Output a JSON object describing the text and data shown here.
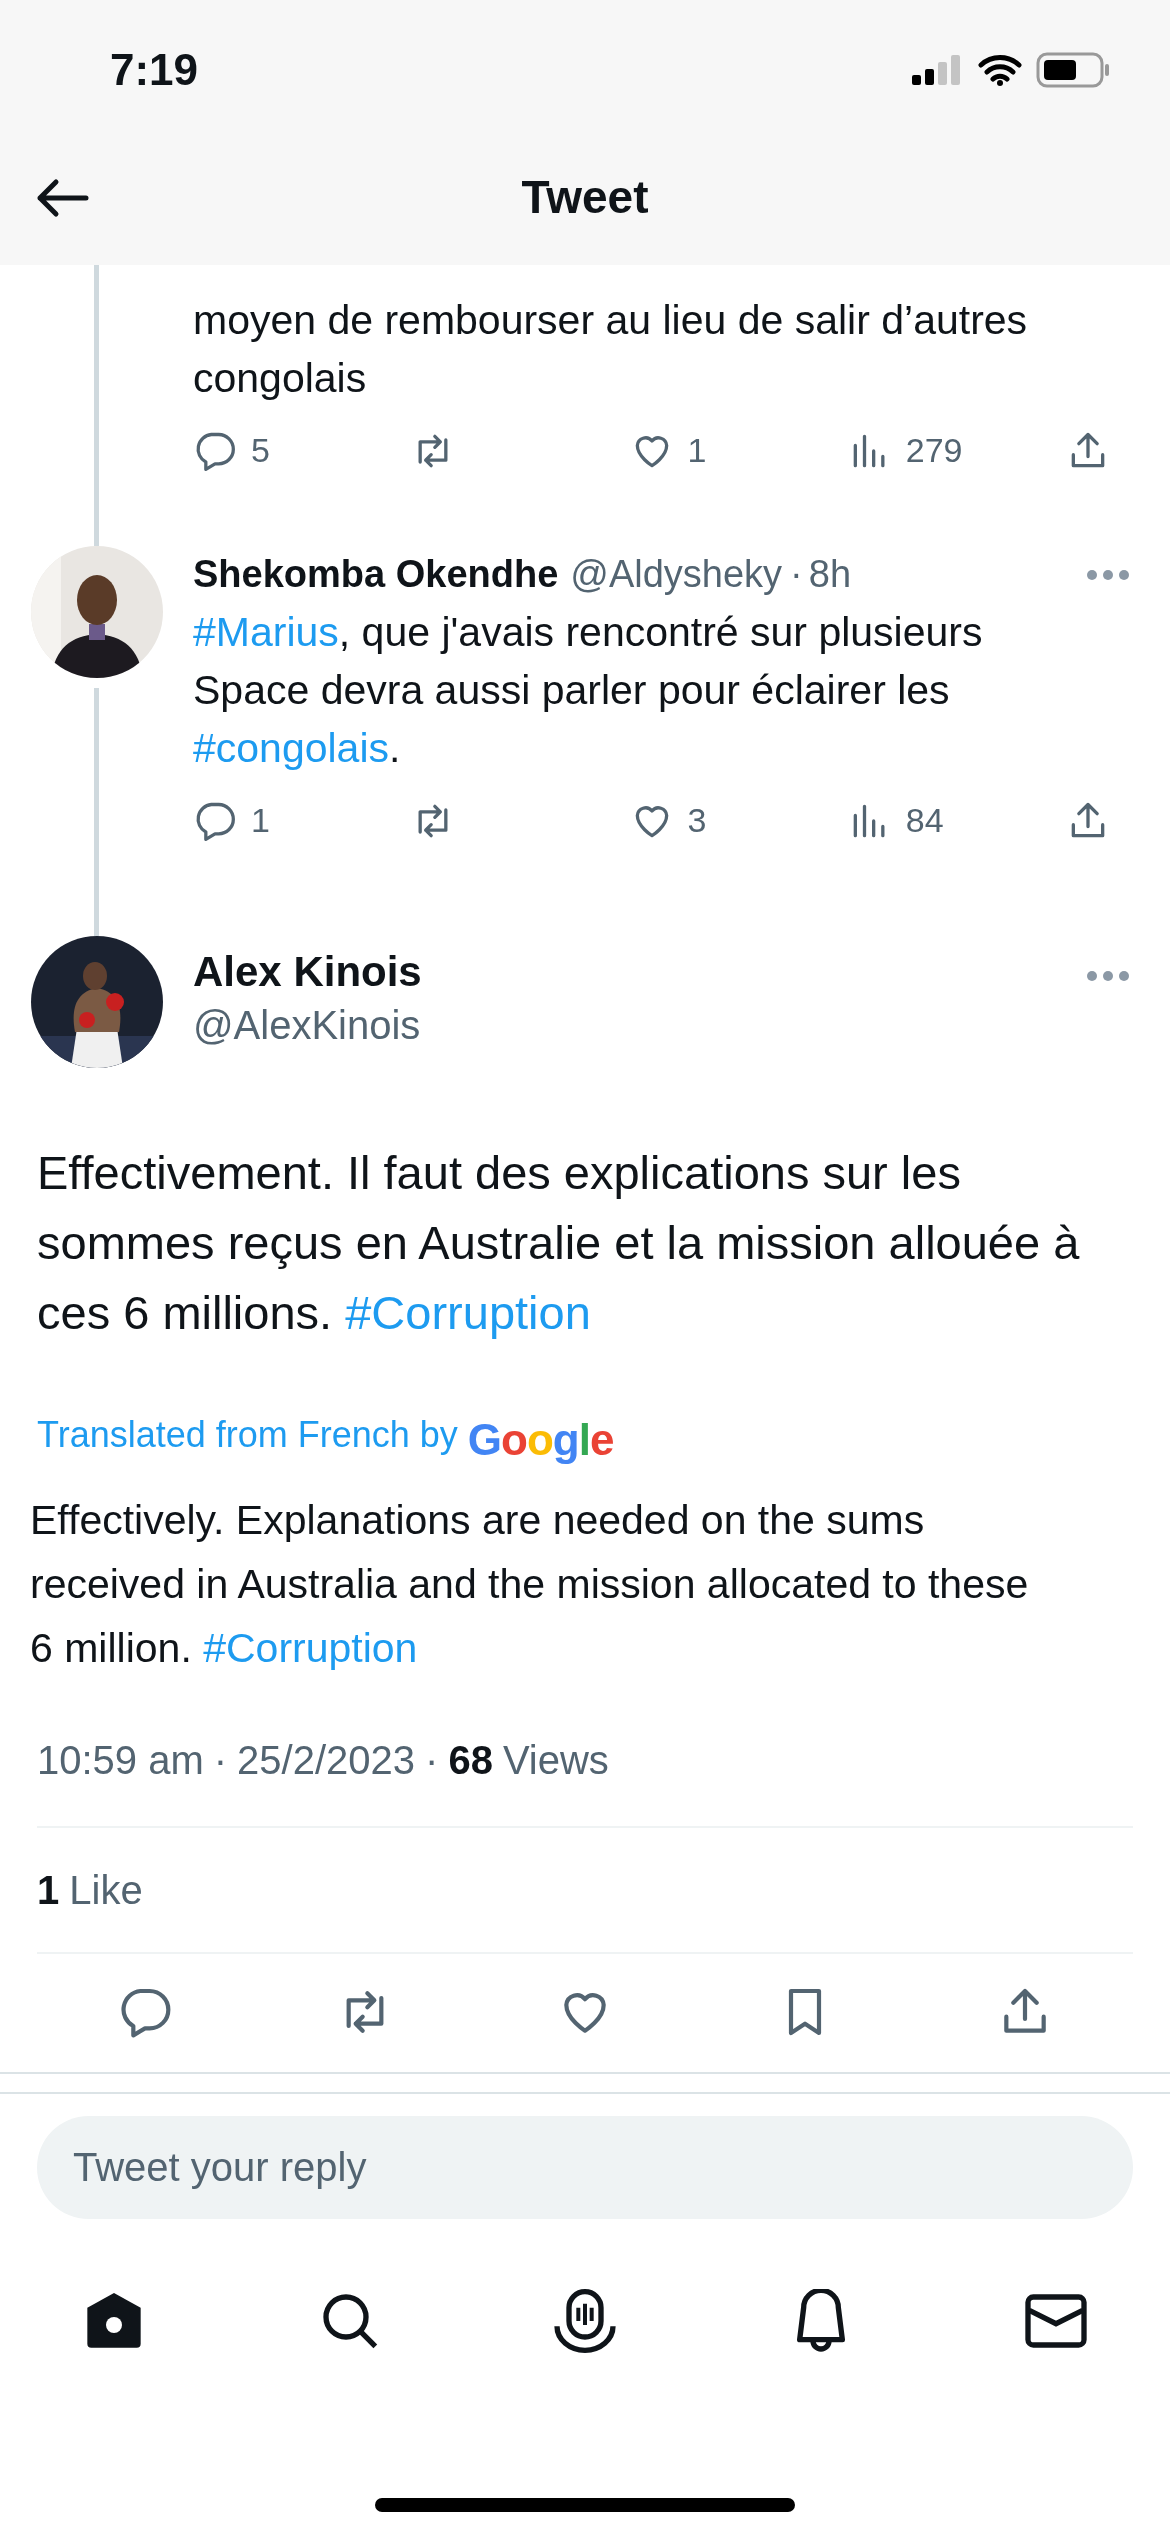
{
  "status_bar": {
    "time": "7:19"
  },
  "header": {
    "title": "Tweet"
  },
  "replies": [
    {
      "text": [
        {
          "kind": "text",
          "value": "moyen de rembourser au lieu de salir d’autres congolais"
        }
      ],
      "stats": {
        "replies": "5",
        "likes": "1",
        "views": "279"
      }
    },
    {
      "author": {
        "name": "Shekomba Okendhe",
        "handle": "@Aldysheky",
        "separator": "·",
        "time": "8h"
      },
      "text": [
        {
          "kind": "hashtag",
          "value": "#Marius"
        },
        {
          "kind": "text",
          "value": ", que j'avais rencontré sur plusieurs Space devra aussi parler pour éclairer les "
        },
        {
          "kind": "hashtag",
          "value": "#congolais"
        },
        {
          "kind": "text",
          "value": "."
        }
      ],
      "stats": {
        "replies": "1",
        "likes": "3",
        "views": "84"
      }
    }
  ],
  "tweet": {
    "author": {
      "name": "Alex Kinois",
      "handle": "@AlexKinois"
    },
    "text": [
      {
        "kind": "text",
        "value": "Effectivement. Il faut des explications sur les sommes reçus en Australie et la mission allouée à ces 6 millions. "
      },
      {
        "kind": "hashtag",
        "value": "#Corruption"
      }
    ],
    "translation_label": "Translated from French by",
    "translation_logo": "Google",
    "translation": [
      {
        "kind": "text",
        "value": "Effectively. Explanations are needed on the sums received in Australia and the mission allocated to these 6 million. "
      },
      {
        "kind": "hashtag",
        "value": "#Corruption"
      }
    ],
    "time": "10:59 am",
    "separator_1": "·",
    "date": "25/2/2023",
    "separator_2": "·",
    "views_count": "68",
    "views_label": "Views",
    "likes_count": "1",
    "likes_label": "Like"
  },
  "reply_field": {
    "placeholder": "Tweet your reply"
  },
  "nav": [
    {
      "kind": "home",
      "selected": true
    },
    {
      "kind": "search",
      "selected": false
    },
    {
      "kind": "spaces",
      "selected": false
    },
    {
      "kind": "notifications",
      "selected": false
    },
    {
      "kind": "messages",
      "selected": false
    }
  ]
}
